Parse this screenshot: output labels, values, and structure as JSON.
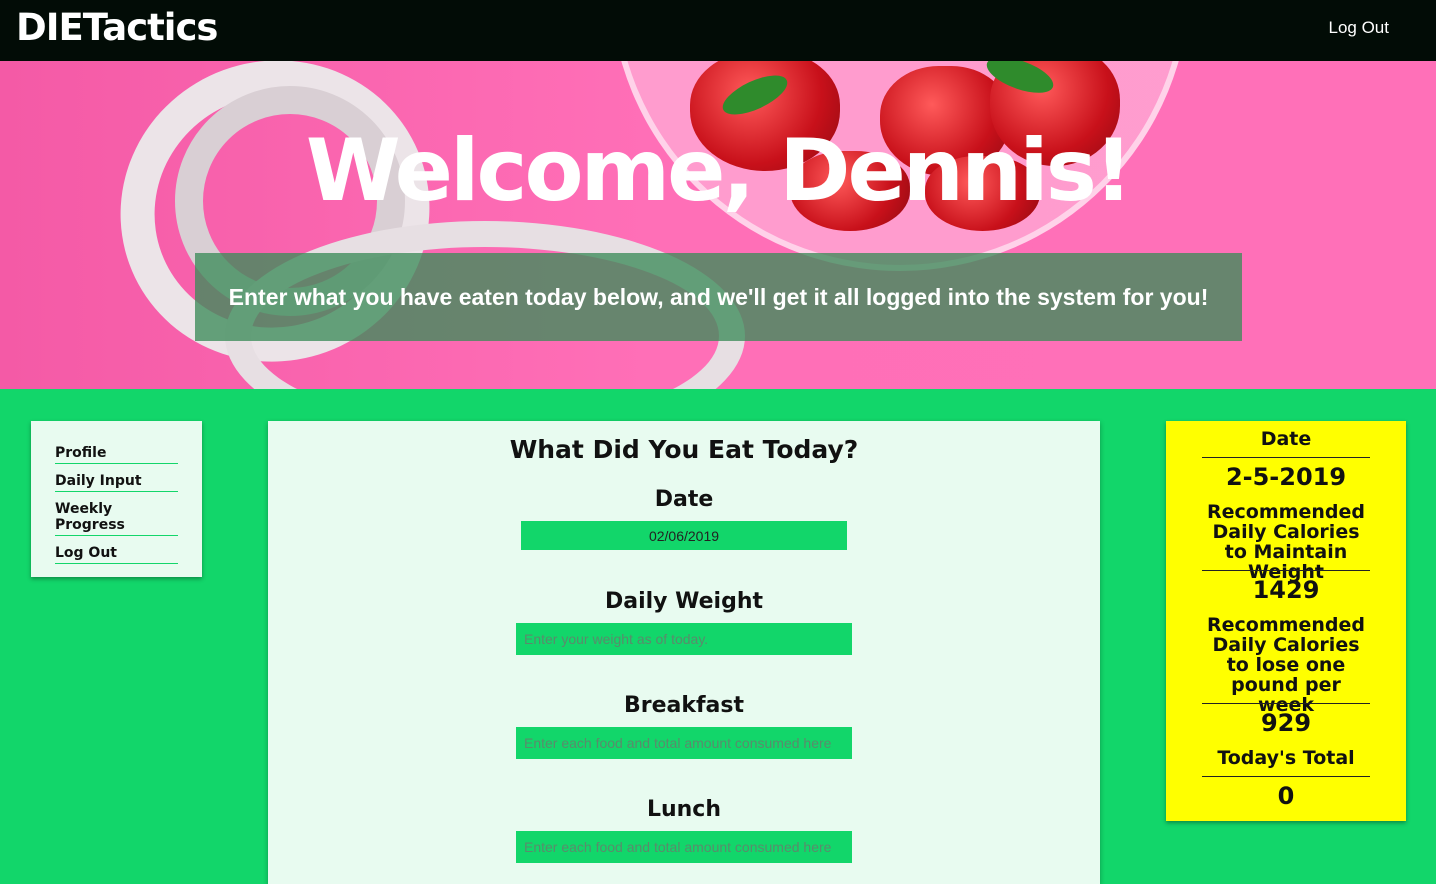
{
  "navbar": {
    "brand": "DIETactics",
    "logout_label": "Log Out"
  },
  "hero": {
    "title": "Welcome, Dennis!",
    "subtitle": "Enter what you have eaten today below, and we'll get it all logged into the system for you!"
  },
  "sidenav": {
    "items": [
      {
        "label": "Profile"
      },
      {
        "label": "Daily Input"
      },
      {
        "label": "Weekly Progress"
      },
      {
        "label": "Log Out"
      }
    ]
  },
  "form": {
    "title": "What Did You Eat Today?",
    "date": {
      "label": "Date",
      "value": "02/06/2019"
    },
    "weight": {
      "label": "Daily Weight",
      "placeholder": "Enter your weight as of today."
    },
    "breakfast": {
      "label": "Breakfast",
      "placeholder": "Enter each food and total amount consumed here"
    },
    "lunch": {
      "label": "Lunch",
      "placeholder": "Enter each food and total amount consumed here"
    }
  },
  "stats": {
    "date_label": "Date",
    "date_value": "2-5-2019",
    "maintain_label": "Recommended Daily Calories to Maintain Weight",
    "maintain_value": "1429",
    "lose_label": "Recommended Daily Calories to lose one pound per week",
    "lose_value": "929",
    "total_label": "Today's Total",
    "total_value": "0"
  },
  "colors": {
    "navbar": "#020c06",
    "accent_green": "#12d66a",
    "card_bg": "#e8fbf0",
    "stats_bg": "#ffff00",
    "hero_pink": "#ff6fb7"
  }
}
